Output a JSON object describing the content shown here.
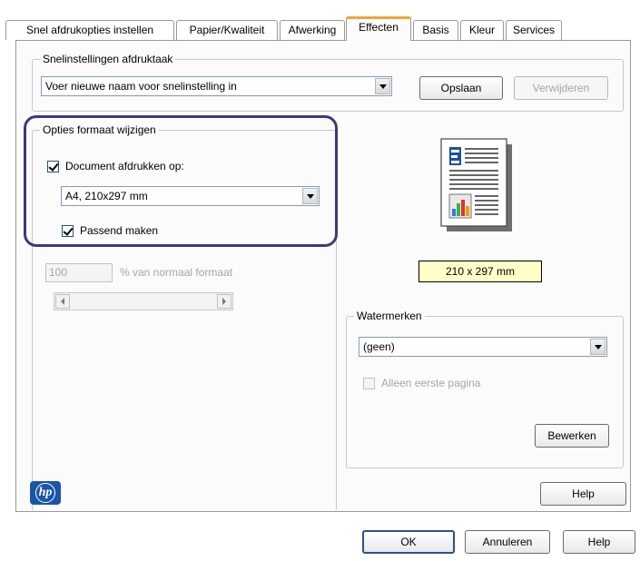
{
  "tabs": [
    {
      "label": "Snel afdrukopties instellen"
    },
    {
      "label": "Papier/Kwaliteit"
    },
    {
      "label": "Afwerking"
    },
    {
      "label": "Effecten",
      "active": true
    },
    {
      "label": "Basis"
    },
    {
      "label": "Kleur"
    },
    {
      "label": "Services"
    }
  ],
  "quick_settings": {
    "group_label": "Snelinstellingen afdruktaak",
    "name_value": "Voer nieuwe naam voor snelinstelling in",
    "save_label": "Opslaan",
    "delete_label": "Verwijderen"
  },
  "resize": {
    "group_label": "Opties formaat wijzigen",
    "print_on_label": "Document afdrukken op:",
    "print_on_checked": true,
    "paper_value": "A4, 210x297 mm",
    "fit_label": "Passend maken",
    "fit_checked": true,
    "percent_value": "100",
    "percent_label": "% van normaal formaat"
  },
  "preview": {
    "size_label": "210 x 297 mm"
  },
  "watermarks": {
    "group_label": "Watermerken",
    "value": "(geen)",
    "first_page_label": "Alleen eerste pagina",
    "first_page_checked": false,
    "edit_label": "Bewerken"
  },
  "footer": {
    "help_label": "Help",
    "logo_text": "hp"
  },
  "dialog_buttons": {
    "ok": "OK",
    "cancel": "Annuleren",
    "help": "Help"
  },
  "colors": {
    "highlight": "#3c3a7a",
    "tab_accent": "#f2a33a",
    "size_badge_bg": "#ffffc8",
    "logo_bg": "#1a55a7"
  }
}
